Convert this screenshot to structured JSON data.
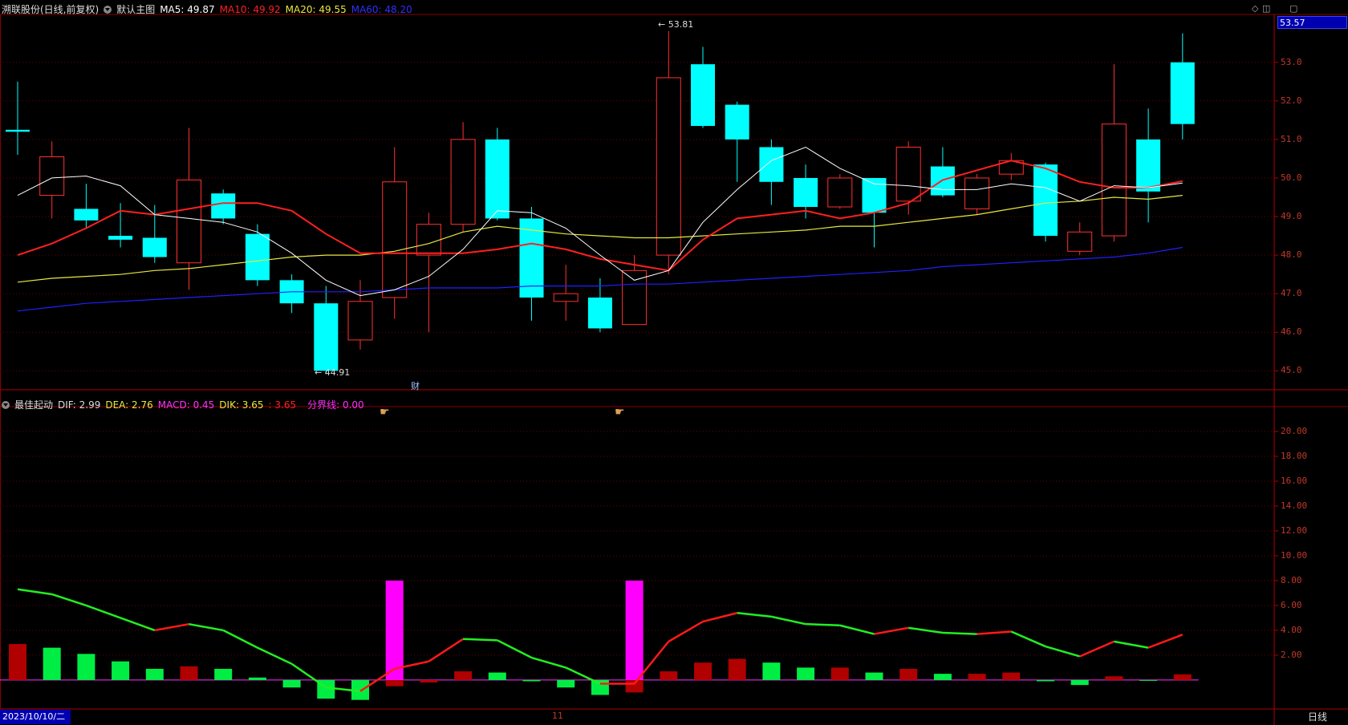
{
  "header": {
    "stock_title": "溯联股份(日线,前复权)",
    "main_label": "默认主图",
    "ma5": "MA5: 49.87",
    "ma10": "MA10: 49.92",
    "ma20": "MA20: 49.55",
    "ma60": "MA60: 48.20",
    "colors": {
      "ma5": "#ffffff",
      "ma10": "#ff2020",
      "ma20": "#e8e840",
      "ma60": "#2020ff",
      "title": "#dddddd"
    }
  },
  "indicator_header": {
    "name": "最佳起动",
    "dif": "DIF: 2.99",
    "dea": "DEA: 2.76",
    "macd": "MACD: 0.45",
    "dik": "DIK: 3.65",
    "dik2": ": 3.65",
    "divider": "分界线: 0.00"
  },
  "price_axis": [
    "53.0",
    "52.0",
    "51.0",
    "50.0",
    "49.0",
    "48.0",
    "47.0",
    "46.0",
    "45.0"
  ],
  "indicator_axis": [
    "20.00",
    "18.00",
    "16.00",
    "14.00",
    "12.00",
    "10.00",
    "8.00",
    "6.00",
    "4.00",
    "2.00"
  ],
  "last_price": "53.57",
  "high_annotation": "53.81",
  "low_annotation": "44.91",
  "event_marker": "财",
  "bottom": {
    "date": "2023/10/10/二",
    "month_tick": "11",
    "period": "日线"
  },
  "chart_data": [
    {
      "type": "candlestick",
      "ylim": [
        44.55,
        54.2
      ],
      "candles": [
        {
          "o": 51.25,
          "c": 51.2,
          "h": 52.5,
          "l": 50.6
        },
        {
          "o": 49.55,
          "c": 50.55,
          "h": 50.95,
          "l": 48.95
        },
        {
          "o": 49.2,
          "c": 48.9,
          "h": 49.85,
          "l": 48.7
        },
        {
          "o": 48.5,
          "c": 48.4,
          "h": 49.35,
          "l": 48.2
        },
        {
          "o": 48.45,
          "c": 47.95,
          "h": 49.3,
          "l": 47.8
        },
        {
          "o": 47.8,
          "c": 49.95,
          "h": 51.3,
          "l": 47.1
        },
        {
          "o": 49.6,
          "c": 48.95,
          "h": 49.7,
          "l": 48.8
        },
        {
          "o": 48.55,
          "c": 47.35,
          "h": 48.8,
          "l": 47.2
        },
        {
          "o": 47.35,
          "c": 46.75,
          "h": 47.5,
          "l": 46.5
        },
        {
          "o": 46.75,
          "c": 45.0,
          "h": 47.2,
          "l": 44.91
        },
        {
          "o": 45.8,
          "c": 46.8,
          "h": 47.35,
          "l": 45.55
        },
        {
          "o": 46.9,
          "c": 49.9,
          "h": 50.8,
          "l": 46.35
        },
        {
          "o": 48.0,
          "c": 48.8,
          "h": 49.1,
          "l": 46.0
        },
        {
          "o": 48.8,
          "c": 51.0,
          "h": 51.45,
          "l": 48.6
        },
        {
          "o": 51.0,
          "c": 48.95,
          "h": 51.3,
          "l": 48.9
        },
        {
          "o": 48.95,
          "c": 46.9,
          "h": 49.25,
          "l": 46.3
        },
        {
          "o": 46.8,
          "c": 47.0,
          "h": 47.75,
          "l": 46.3
        },
        {
          "o": 46.9,
          "c": 46.1,
          "h": 47.4,
          "l": 46.0
        },
        {
          "o": 46.2,
          "c": 47.6,
          "h": 48.0,
          "l": 46.2
        },
        {
          "o": 48.0,
          "c": 52.6,
          "h": 53.81,
          "l": 47.5
        },
        {
          "o": 52.95,
          "c": 51.35,
          "h": 53.4,
          "l": 51.3
        },
        {
          "o": 51.9,
          "c": 51.0,
          "h": 51.98,
          "l": 49.9
        },
        {
          "o": 50.8,
          "c": 49.9,
          "h": 51.0,
          "l": 49.3
        },
        {
          "o": 50.0,
          "c": 49.25,
          "h": 50.35,
          "l": 48.95
        },
        {
          "o": 49.25,
          "c": 50.0,
          "h": 50.1,
          "l": 49.2
        },
        {
          "o": 50.0,
          "c": 49.1,
          "h": 50.0,
          "l": 48.2
        },
        {
          "o": 49.4,
          "c": 50.8,
          "h": 50.95,
          "l": 49.05
        },
        {
          "o": 50.3,
          "c": 49.55,
          "h": 50.8,
          "l": 49.5
        },
        {
          "o": 49.2,
          "c": 50.0,
          "h": 50.1,
          "l": 49.05
        },
        {
          "o": 50.1,
          "c": 50.45,
          "h": 50.65,
          "l": 49.95
        },
        {
          "o": 50.35,
          "c": 48.5,
          "h": 50.4,
          "l": 48.35
        },
        {
          "o": 48.1,
          "c": 48.6,
          "h": 48.85,
          "l": 48.0
        },
        {
          "o": 48.5,
          "c": 51.4,
          "h": 52.95,
          "l": 48.35
        },
        {
          "o": 51.0,
          "c": 49.65,
          "h": 51.8,
          "l": 48.85
        },
        {
          "o": 53.0,
          "c": 51.4,
          "h": 53.75,
          "l": 51.0
        }
      ],
      "ma5": [
        49.55,
        50.0,
        50.05,
        49.8,
        49.05,
        48.95,
        48.85,
        48.6,
        48.05,
        47.35,
        46.95,
        47.1,
        47.45,
        48.15,
        49.15,
        49.1,
        48.7,
        48.0,
        47.35,
        47.6,
        48.85,
        49.7,
        50.45,
        50.8,
        50.25,
        49.85,
        49.8,
        49.7,
        49.7,
        49.85,
        49.75,
        49.4,
        49.8,
        49.75,
        49.87
      ],
      "ma10": [
        48.0,
        48.3,
        48.7,
        49.15,
        49.05,
        49.2,
        49.35,
        49.35,
        49.15,
        48.55,
        48.05,
        48.05,
        48.05,
        48.05,
        48.15,
        48.3,
        48.15,
        47.9,
        47.75,
        47.6,
        48.4,
        48.95,
        49.05,
        49.15,
        48.95,
        49.1,
        49.35,
        49.95,
        50.2,
        50.45,
        50.25,
        49.9,
        49.75,
        49.75,
        49.92
      ],
      "ma20": [
        47.3,
        47.4,
        47.45,
        47.5,
        47.6,
        47.65,
        47.75,
        47.85,
        47.95,
        48.0,
        48.0,
        48.1,
        48.3,
        48.6,
        48.75,
        48.65,
        48.55,
        48.5,
        48.45,
        48.45,
        48.5,
        48.55,
        48.6,
        48.65,
        48.75,
        48.75,
        48.85,
        48.95,
        49.05,
        49.2,
        49.35,
        49.4,
        49.5,
        49.45,
        49.55
      ],
      "ma60": [
        46.55,
        46.65,
        46.75,
        46.8,
        46.85,
        46.9,
        46.95,
        47.0,
        47.05,
        47.05,
        47.05,
        47.1,
        47.15,
        47.15,
        47.15,
        47.2,
        47.2,
        47.2,
        47.25,
        47.25,
        47.3,
        47.35,
        47.4,
        47.45,
        47.5,
        47.55,
        47.6,
        47.7,
        47.75,
        47.8,
        47.85,
        47.9,
        47.95,
        48.05,
        48.2
      ]
    },
    {
      "type": "bar",
      "ylim": [
        -2.2,
        22.0
      ],
      "dik": [
        7.3,
        6.9,
        6.0,
        5.0,
        4.0,
        4.5,
        4.0,
        2.6,
        1.3,
        -0.6,
        -0.9,
        0.9,
        1.5,
        3.3,
        3.2,
        1.8,
        1.0,
        -0.3,
        -0.3,
        3.1,
        4.7,
        5.4,
        5.1,
        4.5,
        4.4,
        3.7,
        4.2,
        3.8,
        3.7,
        3.9,
        2.7,
        1.9,
        3.1,
        2.6,
        3.65
      ],
      "macd": [
        2.9,
        2.6,
        2.1,
        1.5,
        0.9,
        1.1,
        0.9,
        0.2,
        -0.6,
        -1.5,
        -1.6,
        -0.5,
        -0.2,
        0.7,
        0.6,
        -0.1,
        -0.6,
        -1.2,
        -1.0,
        0.7,
        1.4,
        1.7,
        1.4,
        1.0,
        1.0,
        0.6,
        0.9,
        0.5,
        0.5,
        0.6,
        -0.1,
        -0.4,
        0.3,
        -0.05,
        0.45
      ],
      "signals": [
        11,
        18
      ],
      "signal_value": 8.0
    }
  ]
}
